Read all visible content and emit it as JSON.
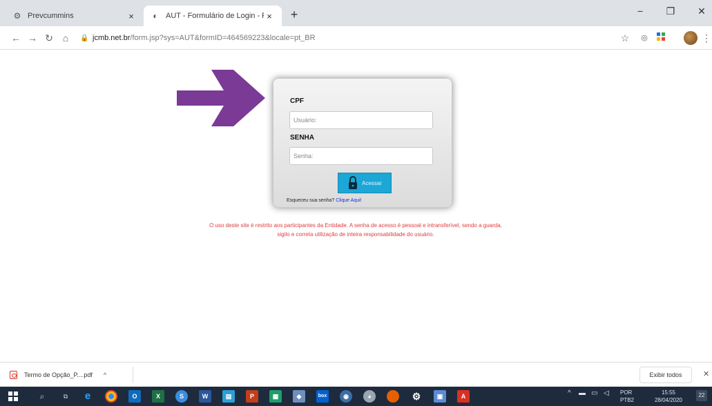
{
  "browser": {
    "tabs": [
      {
        "label": "Prevcummins",
        "close": "×",
        "icon": "⚙"
      },
      {
        "label": "AUT - Formulário de Login - Prev",
        "close": "×",
        "icon": "◐"
      }
    ],
    "new_tab": "+",
    "window_controls": {
      "minimize": "−",
      "restore": "❐",
      "close": "✕"
    },
    "url_domain": "jcmb.net.br",
    "url_path": "/form.jsp?sys=AUT&formID=464569223&locale=pt_BR",
    "nav": {
      "back": "←",
      "forward": "→",
      "reload": "↻",
      "home": "⌂",
      "lock": "🔒",
      "star": "☆",
      "menu": "⋮"
    }
  },
  "arrow_color": "#7b3a96",
  "login": {
    "cpf_label": "CPF",
    "cpf_placeholder": "Usuário:",
    "senha_label": "SENHA",
    "senha_placeholder": "Senha:",
    "button_label": "Acessar",
    "forgot_text": "Esqueceu sua senha?",
    "forgot_link": "Clique Aqui!"
  },
  "notice": {
    "line1": "O uso deste site é restrito aos participantes da Entidade. A senha de acesso é pessoal e intransferível, sendo a guarda,",
    "line2": "sigilo e correta utilização de inteira responsabilidade do usuário."
  },
  "downloads": {
    "file_name": "Termo de Opção_P....pdf",
    "caret": "^",
    "show_all": "Exibir todos",
    "close": "✕"
  },
  "taskbar": {
    "lang_top": "POR",
    "lang_bottom": "PTB2",
    "time": "15:55",
    "date": "28/04/2020",
    "notif_count": "22"
  }
}
